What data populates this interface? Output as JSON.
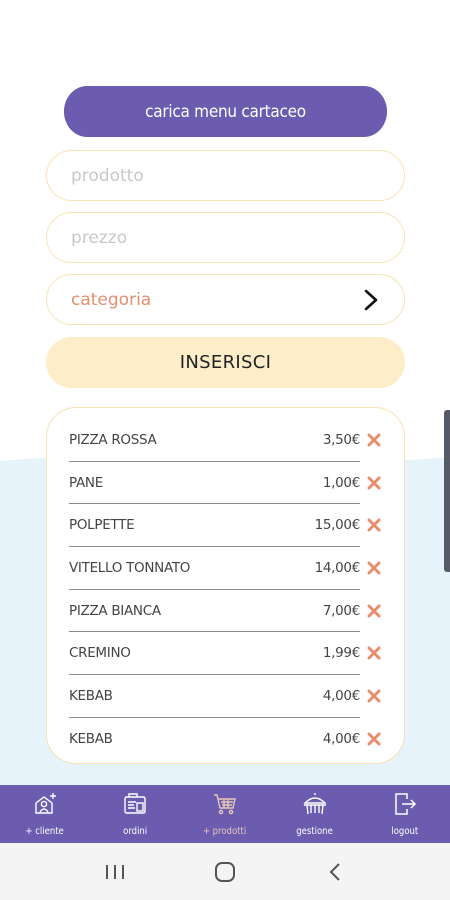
{
  "upload_button": "carica menu cartaceo",
  "form": {
    "product_placeholder": "prodotto",
    "price_placeholder": "prezzo",
    "category_label": "categoria",
    "insert_label": "INSERISCI"
  },
  "items": [
    {
      "name": "PIZZA ROSSA",
      "price": "3,50€"
    },
    {
      "name": "PANE",
      "price": "1,00€"
    },
    {
      "name": "POLPETTE",
      "price": "15,00€"
    },
    {
      "name": "VITELLO TONNATO",
      "price": "14,00€"
    },
    {
      "name": "PIZZA BIANCA",
      "price": "7,00€"
    },
    {
      "name": "CREMINO",
      "price": "1,99€"
    },
    {
      "name": "KEBAB",
      "price": "4,00€"
    },
    {
      "name": "KEBAB",
      "price": "4,00€"
    }
  ],
  "tabs": [
    {
      "label": "+ cliente",
      "icon": "add-user-icon",
      "active": false
    },
    {
      "label": "ordini",
      "icon": "orders-icon",
      "active": false
    },
    {
      "label": "+ prodotti",
      "icon": "cart-icon",
      "active": true
    },
    {
      "label": "gestione",
      "icon": "management-icon",
      "active": false
    },
    {
      "label": "logout",
      "icon": "logout-icon",
      "active": false
    }
  ],
  "colors": {
    "primary": "#6b5cb0",
    "accent_light": "#fdeec9",
    "border": "#f8e3b4",
    "delete": "#e58e6e",
    "background_wave": "#e6f3fa"
  }
}
